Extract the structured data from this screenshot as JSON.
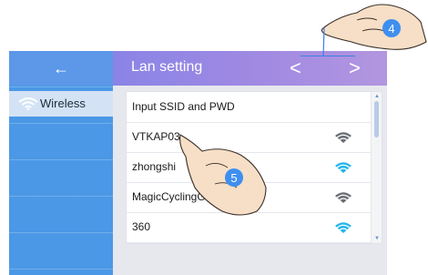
{
  "header": {
    "back_icon": "←",
    "title": "Lan setting",
    "prev_icon": "<",
    "next_icon": ">"
  },
  "sidebar": {
    "items": [
      {
        "label": "Wireless",
        "icon": "wifi-icon"
      }
    ]
  },
  "list": {
    "items": [
      {
        "label": "Input SSID and PWD"
      },
      {
        "label": "VTKAP03",
        "signal": "gray"
      },
      {
        "label": "zhongshi",
        "signal": "blue"
      },
      {
        "label": "MagicCyclingGuest",
        "signal": "gray"
      },
      {
        "label": "360",
        "signal": "blue"
      }
    ]
  },
  "callouts": {
    "step_top": "4",
    "step_list": "5"
  },
  "colors": {
    "sidebar": "#4b98e6",
    "header_start": "#8a84e6",
    "header_end": "#b296e0",
    "wifi_blue": "#25b6ea",
    "wifi_gray": "#6b6f75"
  }
}
